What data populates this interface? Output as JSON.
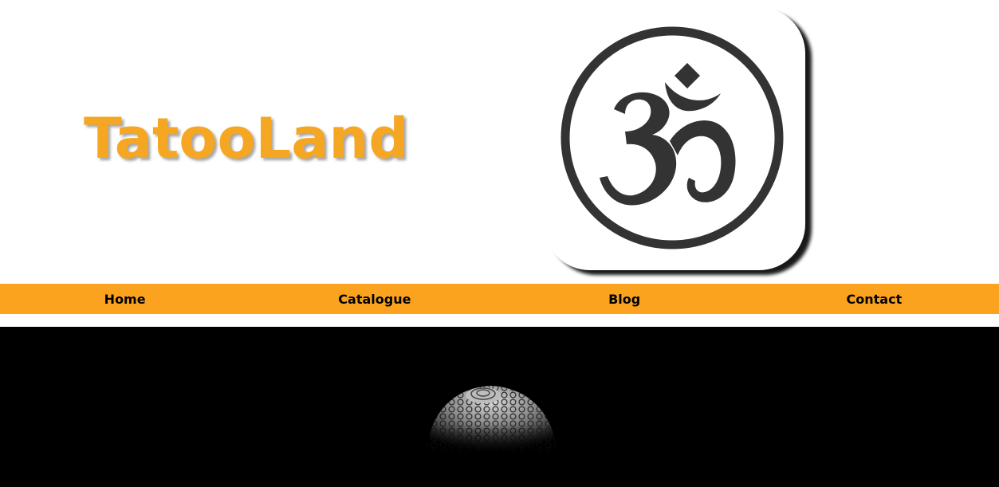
{
  "site": {
    "title": "TatooLand",
    "title_color": "#f5a623",
    "logo_icon": "om-symbol-icon"
  },
  "nav": {
    "background": "#fba31e",
    "items": [
      {
        "label": "Home"
      },
      {
        "label": "Catalogue"
      },
      {
        "label": "Blog"
      },
      {
        "label": "Contact"
      }
    ]
  },
  "hero": {
    "background": "#000000",
    "image": "buddha-head-in-darkness"
  }
}
